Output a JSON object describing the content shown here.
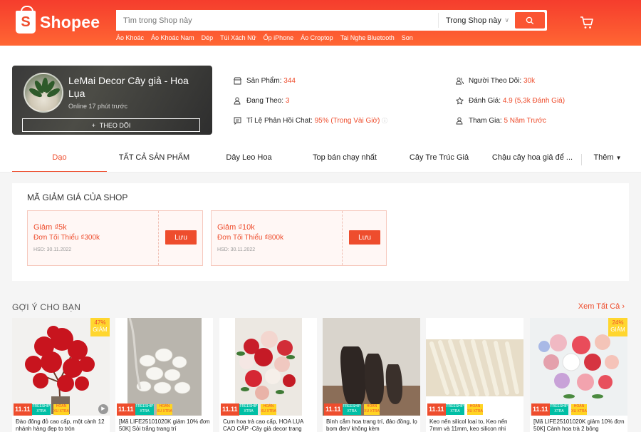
{
  "header": {
    "logo_text": "Shopee",
    "search_placeholder": "Tìm trong Shop này",
    "search_scope": "Trong Shop này",
    "quick_links": [
      "Áo Khoác",
      "Áo Khoác Nam",
      "Dép",
      "Túi Xách Nữ",
      "Ốp iPhone",
      "Áo Croptop",
      "Tai Nghe Bluetooth",
      "Son"
    ]
  },
  "shop": {
    "name": "LeMai Decor Cây giả - Hoa Lụa",
    "online": "Online 17 phút trước",
    "follow_label": "THEO DÕI",
    "stats": {
      "products_label": "Sản Phẩm:",
      "products_value": "344",
      "following_label": "Đang Theo:",
      "following_value": "3",
      "chat_label": "Tỉ Lệ Phản Hồi Chat:",
      "chat_value": "95% (Trong Vài Giờ)",
      "followers_label": "Người Theo Dõi:",
      "followers_value": "30k",
      "rating_label": "Đánh Giá:",
      "rating_value": "4.9 (5,3k Đánh Giá)",
      "joined_label": "Tham Gia:",
      "joined_value": "5 Năm Trước"
    }
  },
  "tabs": [
    "Dạo",
    "TẤT CẢ SẢN PHẨM",
    "Dây Leo Hoa",
    "Top bán chạy nhất",
    "Cây Tre Trúc Giả",
    "Chậu cây hoa giả để ..."
  ],
  "more_tab": "Thêm",
  "vouchers": {
    "title": "MÃ GIẢM GIÁ CỦA SHOP",
    "items": [
      {
        "discount": "Giảm ₫5k",
        "min": "Đơn Tối Thiểu ₫300k",
        "expiry": "HSD: 30.11.2022",
        "button": "Lưu"
      },
      {
        "discount": "Giảm ₫10k",
        "min": "Đơn Tối Thiểu ₫800k",
        "expiry": "HSD: 30.11.2022",
        "button": "Lưu"
      }
    ]
  },
  "recommend": {
    "title": "GỢI Ý CHO BẠN",
    "see_all": "Xem Tất Cả",
    "badge_sale": "11.11",
    "badge_freeship": "FREESHIP XTRA",
    "badge_xtra": "HOÀN XU XTRA",
    "discount_label": "GIẢM",
    "products": [
      {
        "name": "Đào đông đỏ cao cấp, một cành 12 nhánh hàng đẹp to tròn",
        "discount": "47%"
      },
      {
        "name": "[Mã LIFE25101020K giảm 10% đơn 50K] Sỏi trắng trang trí",
        "discount": ""
      },
      {
        "name": "Cụm hoa trà cao cấp, HOA LỤA CAO CẤP -Cây giả decor trang",
        "discount": ""
      },
      {
        "name": "Bình cắm hoa trang trí, đáo đồng, lọ bom đen/ không kèm",
        "discount": ""
      },
      {
        "name": "Keo nến silicol loại to, Keo nến 7mm và 11mm, keo silicon nhi",
        "discount": ""
      },
      {
        "name": "[Mã LIFE25101020K giảm 10% đơn 50K] Cành hoa trà 2 bông",
        "discount": "24%"
      }
    ]
  },
  "colors": {
    "brand": "#ee4d2d",
    "teal": "#00bfa5",
    "yellow": "#ffd424"
  }
}
